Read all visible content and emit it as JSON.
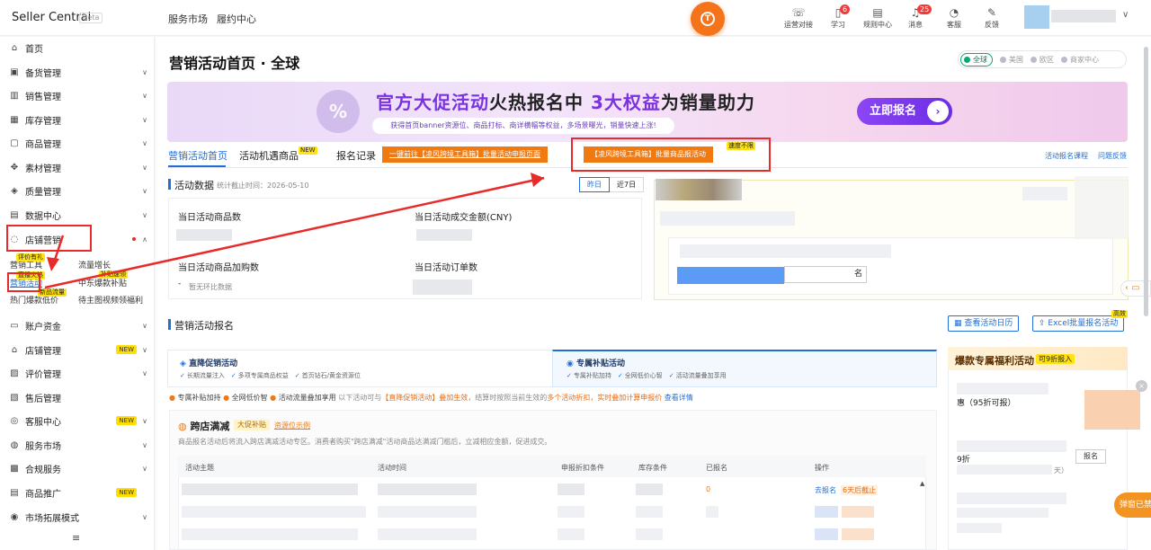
{
  "topbar": {
    "logo": "Seller Central",
    "beta": "Beta",
    "nav": [
      "服务市场",
      "履约中心"
    ],
    "fab_label": "T",
    "icons": [
      {
        "icon": "headset-icon",
        "label": "运营对接",
        "badge": ""
      },
      {
        "icon": "book-icon",
        "label": "学习",
        "badge": "6"
      },
      {
        "icon": "rules-icon",
        "label": "规则中心",
        "badge": ""
      },
      {
        "icon": "bell-icon",
        "label": "消息",
        "badge": "25"
      },
      {
        "icon": "support-icon",
        "label": "客服",
        "badge": ""
      },
      {
        "icon": "feedback-icon",
        "label": "反馈",
        "badge": ""
      }
    ]
  },
  "sidebar": {
    "items": [
      {
        "label": "首页",
        "icon": "home-icon"
      },
      {
        "label": "备货管理",
        "icon": "stock-icon"
      },
      {
        "label": "销售管理",
        "icon": "sales-icon"
      },
      {
        "label": "库存管理",
        "icon": "warehouse-icon"
      },
      {
        "label": "商品管理",
        "icon": "product-icon"
      },
      {
        "label": "素材管理",
        "icon": "material-icon"
      },
      {
        "label": "质量管理",
        "icon": "quality-icon"
      },
      {
        "label": "数据中心",
        "icon": "data-icon"
      },
      {
        "label": "店铺营销",
        "icon": "marketing-icon"
      },
      {
        "label": "账户资金",
        "icon": "account-icon"
      },
      {
        "label": "店铺管理",
        "icon": "store-icon"
      },
      {
        "label": "评价管理",
        "icon": "review-icon"
      },
      {
        "label": "售后管理",
        "icon": "aftersale-icon"
      },
      {
        "label": "客服中心",
        "icon": "service-icon"
      },
      {
        "label": "服务市场",
        "icon": "market-icon"
      },
      {
        "label": "合规服务",
        "icon": "compliance-icon"
      },
      {
        "label": "商品推广",
        "icon": "promo-icon"
      },
      {
        "label": "市场拓展模式",
        "icon": "expand-icon"
      }
    ],
    "new_label": "NEW",
    "subitems": {
      "s1": "营销工具",
      "s2": "流量增长",
      "s3": "营销活动",
      "s4": "中东爆款补贴",
      "s5": "热门爆款低价",
      "s6": "待主图视频领福利"
    },
    "tags": {
      "t1": "评价有礼",
      "t2": "补贴速领",
      "t3": "直播火热",
      "t4": "新品流量"
    }
  },
  "page": {
    "title": "营销活动首页 · 全球",
    "regions": [
      "全球",
      "美国",
      "欧区",
      "商家中心"
    ]
  },
  "banner": {
    "title_a": "官方大促活动",
    "title_b": "火热报名中",
    "title_c": "3大权益",
    "title_d": "为销量助力",
    "sub": "获得首页banner资源位、商品打标、商详横幅等权益，多场景曝光，销量快速上涨!",
    "cta": "立即报名",
    "circle": "%"
  },
  "tabs": {
    "t1": "营销活动首页",
    "t2": "活动机遇商品",
    "new": "NEW",
    "t3": "报名记录",
    "btn1": "一键前往【凌风跨境工具箱】批量活动申报页面",
    "btn2": "【凌风跨境工具箱】批量商品报活动",
    "btn2_tag": "速度不限",
    "link1": "活动报名课程",
    "link2": "问题反馈"
  },
  "activity_data": {
    "title": "活动数据",
    "stat_time": "统计截止时间：2026-05-10",
    "toggle_today": "昨日",
    "toggle_7": "近7日",
    "l1": "当日活动商品数",
    "l2": "当日活动成交金额(CNY)",
    "l3": "当日活动商品加购数",
    "l4": "当日活动订单数",
    "compare": "暂无环比数据",
    "dash": "-",
    "cut_btn": "名"
  },
  "signup": {
    "title": "营销活动报名",
    "btn1": "查看活动日历",
    "btn2": "Excel批量报名活动",
    "btn2_tag": "高效",
    "tab1": {
      "title": "直降促销活动",
      "p1": "长期流量注入",
      "p2": "多项专属商品权益",
      "p3": "首页钻石/黄金资源位"
    },
    "tab2": {
      "title": "专属补贴活动",
      "p1": "专属补贴加持",
      "p2": "全网低价心智",
      "p3": "活动流量叠加享用"
    },
    "info_a": "专属补贴加持",
    "info_b": "全网低价智",
    "info_c": "活动流量叠加享用",
    "info_d": "以下活动可与",
    "info_e": "【直降促销活动】叠加生效",
    "info_f": "，结算时按照当前生效的",
    "info_g": "多个活动折扣，实时叠加计算申报价",
    "info_h": "查看详情"
  },
  "reduction": {
    "title": "跨店满减",
    "tag": "大促补贴",
    "link": "资源位示例",
    "desc": "商品报名活动后将流入跨店满减活动专区。消费者购买\"跨店满减\"活动商品达满减门槛后，立减相应金额，促进成交。",
    "headers": [
      "活动主题",
      "活动时间",
      "申报折扣条件",
      "库存条件",
      "已报名",
      "操作"
    ],
    "row1": {
      "signed": "0",
      "op": "去报名",
      "deadline": "6天后截止"
    }
  },
  "welfare": {
    "title": "爆款专属福利活动",
    "tag": "可9折报入",
    "i1": "惠（95折可报）",
    "i2": "9折",
    "i3": "天）",
    "btn": "报名"
  },
  "floating": {
    "tip": "弹窗已禁",
    "close": "×",
    "chat": "‹ ▭"
  },
  "colors": {
    "accent": "#1f6fd6",
    "orange": "#f07a10",
    "purple": "#7b33e0",
    "red_box": "#e82a2a"
  }
}
